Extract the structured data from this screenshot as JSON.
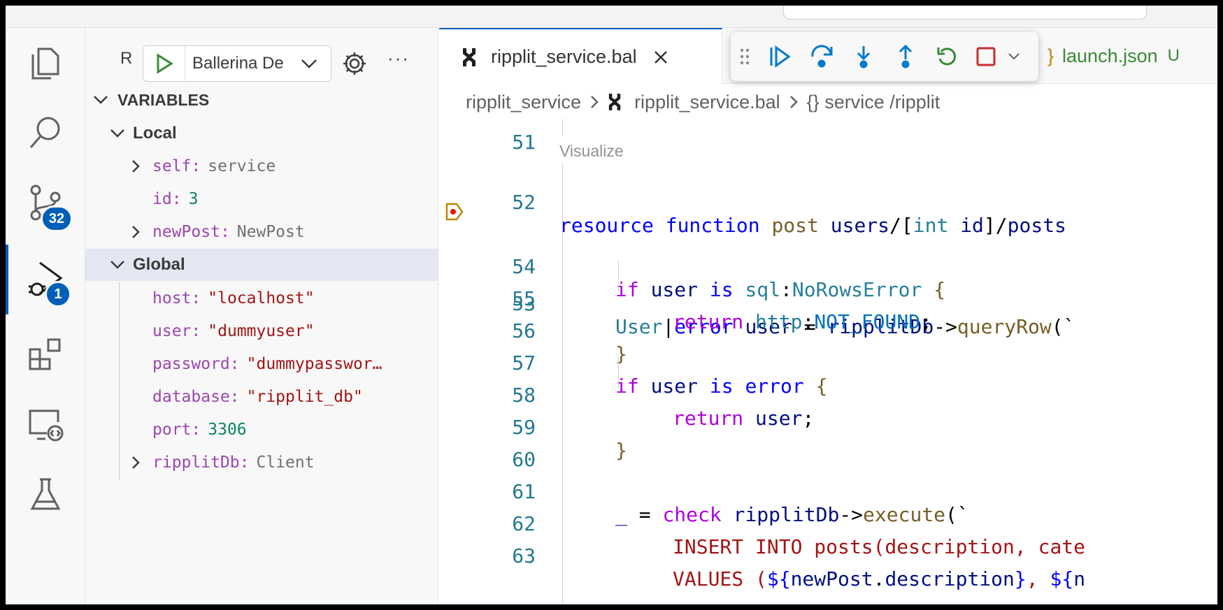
{
  "sidebar": {
    "title_letter": "R",
    "launch_config": "Ballerina De",
    "variables_header": "VARIABLES",
    "local_header": "Local",
    "global_header": "Global",
    "local_vars": [
      {
        "name": "self",
        "value": "service",
        "kind": "type",
        "expandable": true
      },
      {
        "name": "id",
        "value": "3",
        "kind": "num",
        "expandable": false
      },
      {
        "name": "newPost",
        "value": "NewPost",
        "kind": "type",
        "expandable": true
      }
    ],
    "global_vars": [
      {
        "name": "host",
        "value": "\"localhost\"",
        "kind": "str",
        "expandable": false
      },
      {
        "name": "user",
        "value": "\"dummyuser\"",
        "kind": "str",
        "expandable": false
      },
      {
        "name": "password",
        "value": "\"dummypasswor…",
        "kind": "str",
        "expandable": false
      },
      {
        "name": "database",
        "value": "\"ripplit_db\"",
        "kind": "str",
        "expandable": false
      },
      {
        "name": "port",
        "value": "3306",
        "kind": "num",
        "expandable": false
      },
      {
        "name": "ripplitDb",
        "value": "Client",
        "kind": "type",
        "expandable": true
      }
    ]
  },
  "activity": {
    "scm_badge": "32",
    "debug_badge": "1"
  },
  "editor": {
    "active_tab": "ripplit_service.bal",
    "other_tab": "launch.json",
    "other_tab_status": "U",
    "other_tab_brace": "}",
    "breadcrumb": [
      "ripplit_service",
      "ripplit_service.bal",
      "{} service /ripplit"
    ],
    "codelens": "Visualize",
    "top_partial_line": "51",
    "current_line": "53"
  }
}
